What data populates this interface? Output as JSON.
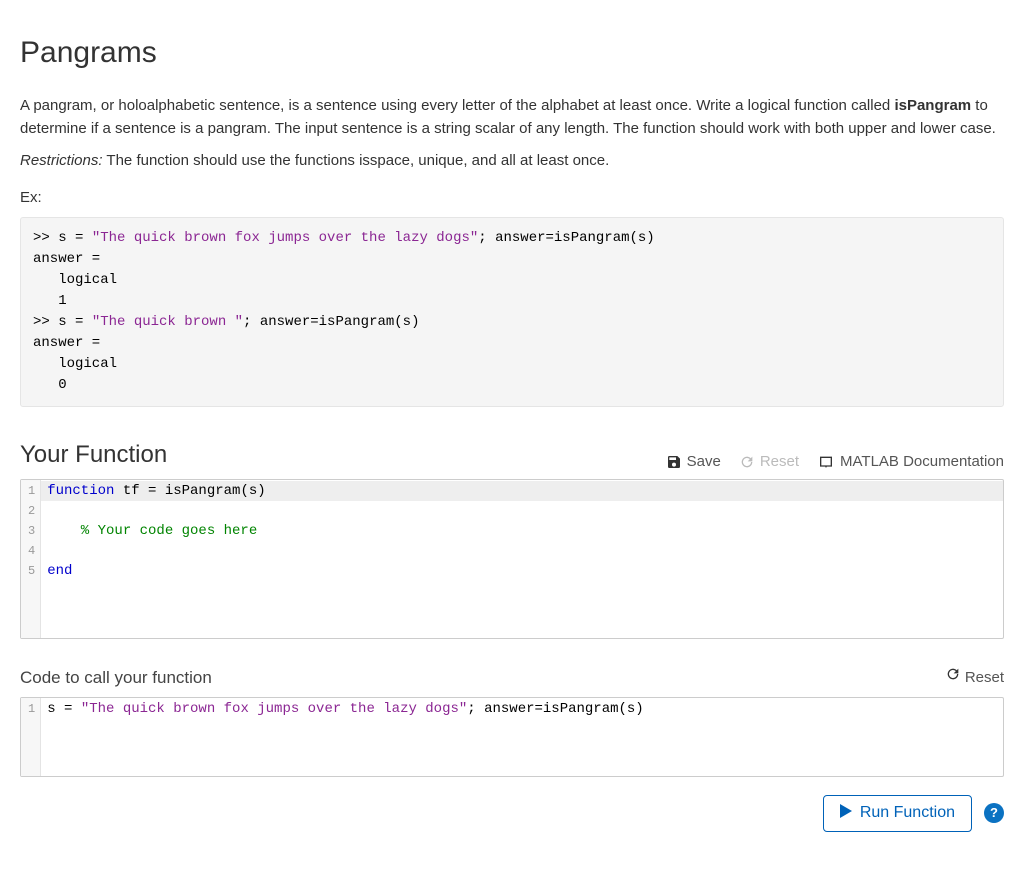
{
  "page": {
    "title": "Pangrams",
    "intro_before_bold": "A pangram, or holoalphabetic sentence, is a sentence using every letter of the alphabet at least once.  Write a logical function called ",
    "intro_bold": "isPangram",
    "intro_after_bold": " to determine if a sentence is a pangram.  The input sentence is a string scalar of any length. The function should work with both upper and lower case.",
    "restrictions_label": "Restrictions:",
    "restrictions_body": "  The function should use the functions isspace, unique, and all at least once.",
    "ex_label": "Ex:"
  },
  "example": {
    "lines": [
      {
        "parts": [
          {
            "text": ">> s = ",
            "cls": "code"
          },
          {
            "text": "\"The quick brown fox jumps over the lazy dogs\"",
            "cls": "str"
          },
          {
            "text": "; answer=isPangram(s)",
            "cls": "code"
          }
        ]
      },
      {
        "parts": [
          {
            "text": "answer =",
            "cls": "code"
          }
        ]
      },
      {
        "parts": [
          {
            "text": "   logical",
            "cls": "code"
          }
        ]
      },
      {
        "parts": [
          {
            "text": "   1",
            "cls": "code"
          }
        ]
      },
      {
        "parts": [
          {
            "text": ">> s = ",
            "cls": "code"
          },
          {
            "text": "\"The quick brown \"",
            "cls": "str"
          },
          {
            "text": "; answer=isPangram(s)",
            "cls": "code"
          }
        ]
      },
      {
        "parts": [
          {
            "text": "answer =",
            "cls": "code"
          }
        ]
      },
      {
        "parts": [
          {
            "text": "   logical",
            "cls": "code"
          }
        ]
      },
      {
        "parts": [
          {
            "text": "   0",
            "cls": "code"
          }
        ]
      }
    ]
  },
  "func_section": {
    "title": "Your Function",
    "toolbar": {
      "save": "Save",
      "reset": "Reset",
      "docs": "MATLAB Documentation"
    },
    "editor": {
      "lines": [
        {
          "n": "1",
          "hl": true,
          "parts": [
            {
              "text": "function",
              "cls": "kw"
            },
            {
              "text": " tf = isPangram(s)",
              "cls": "code"
            }
          ]
        },
        {
          "n": "2",
          "hl": false,
          "parts": []
        },
        {
          "n": "3",
          "hl": false,
          "parts": [
            {
              "text": "    % Your code goes here",
              "cls": "com"
            }
          ]
        },
        {
          "n": "4",
          "hl": false,
          "parts": []
        },
        {
          "n": "5",
          "hl": false,
          "parts": [
            {
              "text": "end",
              "cls": "kw"
            }
          ]
        }
      ]
    }
  },
  "call_section": {
    "title": "Code to call your function",
    "reset": "Reset",
    "editor": {
      "lines": [
        {
          "n": "1",
          "hl": false,
          "parts": [
            {
              "text": "s = ",
              "cls": "code"
            },
            {
              "text": "\"The quick brown fox jumps over the lazy dogs\"",
              "cls": "str"
            },
            {
              "text": "; answer=isPangram(s)",
              "cls": "code"
            }
          ]
        }
      ]
    }
  },
  "actions": {
    "run": "Run Function",
    "help": "?"
  }
}
